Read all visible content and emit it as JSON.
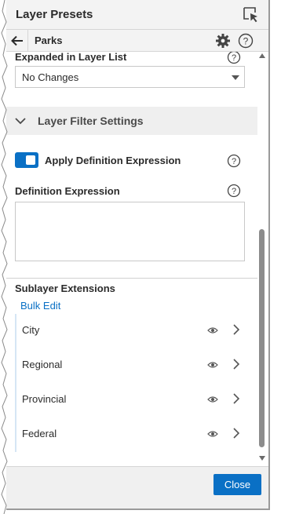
{
  "header": {
    "title": "Layer Presets"
  },
  "navbar": {
    "title": "Parks"
  },
  "expanded": {
    "label": "Expanded in Layer List",
    "dropdown_value": "No Changes"
  },
  "filter_section": {
    "title": "Layer Filter Settings",
    "toggle_label": "Apply Definition Expression",
    "toggle_on": true,
    "expression_label": "Definition Expression",
    "expression_value": ""
  },
  "sublayers": {
    "title": "Sublayer Extensions",
    "bulk_edit_label": "Bulk Edit",
    "items": [
      {
        "label": "City"
      },
      {
        "label": "Regional"
      },
      {
        "label": "Provincial"
      },
      {
        "label": "Federal"
      }
    ]
  },
  "footer": {
    "close_label": "Close"
  },
  "colors": {
    "accent": "#0a70c5",
    "header_bg": "#f3f3f3",
    "section_bg": "#efefef"
  },
  "icons": {
    "select": "cursor-select-icon",
    "back": "arrow-left-icon",
    "settings": "gear-icon",
    "help": "help-icon",
    "dropdown": "caret-down-icon",
    "section": "chevron-down-icon",
    "visibility": "eye-icon",
    "drill": "chevron-right-icon"
  }
}
